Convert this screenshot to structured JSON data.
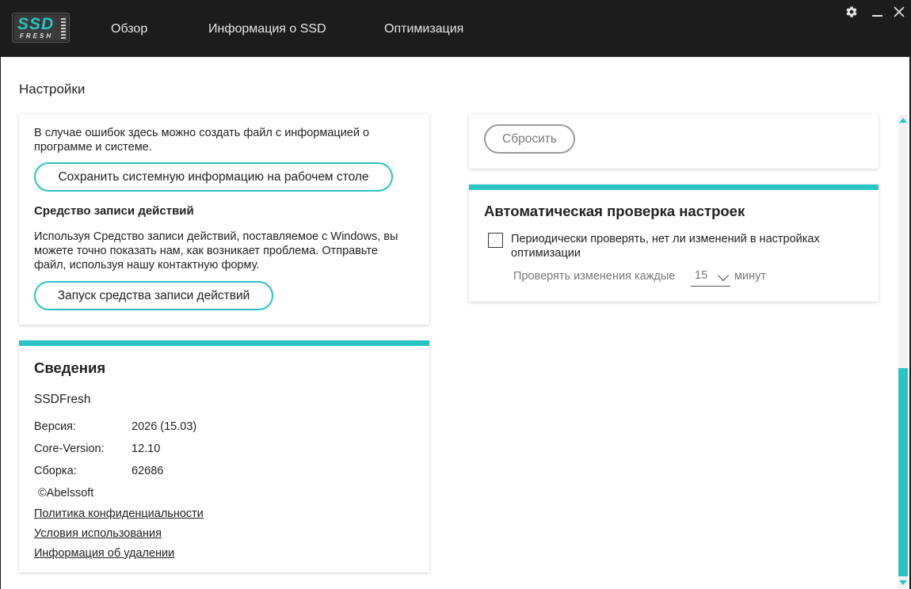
{
  "app": {
    "logo_text_top": "SSD",
    "logo_text_bottom": "FRESH",
    "nav": [
      "Обзор",
      "Информация о SSD",
      "Оптимизация"
    ],
    "icons": {
      "settings": "gear-icon",
      "minimize": "minimize-icon",
      "close": "close-icon"
    },
    "accent_color": "#2bc3c3",
    "titlebar_color": "#1c1c1c"
  },
  "page": {
    "title": "Настройки"
  },
  "support": {
    "sysinfo_text": "В случае ошибок здесь можно создать файл с информацией о программе и системе.",
    "sysinfo_button": "Сохранить системную информацию на рабочем столе",
    "recorder_title": "Средство записи действий",
    "recorder_text": "Используя Средство записи действий, поставляемое с Windows, вы можете точно показать нам, как возникает проблема. Отправьте файл, используя нашу контактную форму.",
    "recorder_button": "Запуск средства записи действий"
  },
  "reset": {
    "button": "Сбросить"
  },
  "about": {
    "title": "Сведения",
    "product": "SSDFresh",
    "rows": [
      {
        "label": "Версия:",
        "value": "2026 (15.03)"
      },
      {
        "label": "Core-Version:",
        "value": "12.10"
      },
      {
        "label": "Сборка:",
        "value": "62686"
      }
    ],
    "copyright": "©Abelssoft",
    "links": [
      "Политика конфиденциальности",
      "Условия использования",
      "Информация об удалении"
    ]
  },
  "auto_check": {
    "title": "Автоматическая проверка настроек",
    "checkbox_label": "Периодически проверять, нет ли изменений в настройках оптимизации",
    "checked": false,
    "interval_prefix": "Проверять изменения каждые",
    "interval_value": "15",
    "interval_suffix": "минут"
  }
}
